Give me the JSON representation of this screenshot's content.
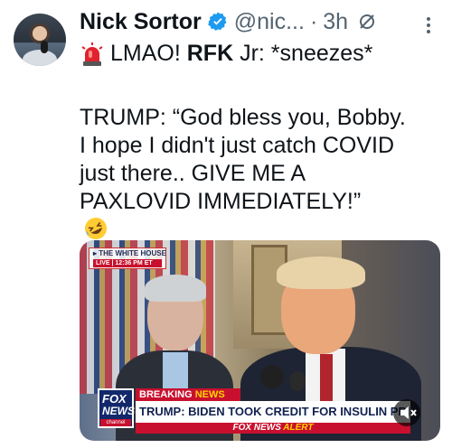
{
  "author": {
    "name": "Nick Sortor",
    "handle": "@nic...",
    "separator": "·",
    "time": "3h"
  },
  "tweet": {
    "line1_text": "LMAO!",
    "line1_bold": "RFK",
    "line1_rest": "Jr: *sneezes*",
    "para_lines": [
      "TRUMP: “God bless you, Bobby.",
      "I hope I didn't just catch COVID",
      "just there.. GIVE ME A",
      "PAXLOVID IMMEDIATELY!”"
    ]
  },
  "media": {
    "bug_title": "▸ THE WHITE HOUSE",
    "bug_live": "LIVE | 12:36 PM ET",
    "breaking_label_1": "BREAKING",
    "breaking_label_2": "NEWS",
    "headline": "TRUMP: BIDEN TOOK CREDIT FOR INSULIN PRICE C",
    "alert_bar_1": "FOX NEWS",
    "alert_bar_2": "ALERT",
    "logo_line1": "FOX",
    "logo_line2": "NEWS",
    "logo_line3": "channel"
  },
  "icons": {
    "verified": "verified-badge-icon",
    "grok": "grok-icon",
    "more": "more-options-icon",
    "siren": "siren-emoji",
    "laugh": "rolling-laughing-emoji",
    "mute": "mute-icon"
  },
  "colors": {
    "verified": "#1d9bf0",
    "muted_text": "#536471",
    "fox_red": "#c8102e",
    "fox_blue": "#12286b"
  }
}
